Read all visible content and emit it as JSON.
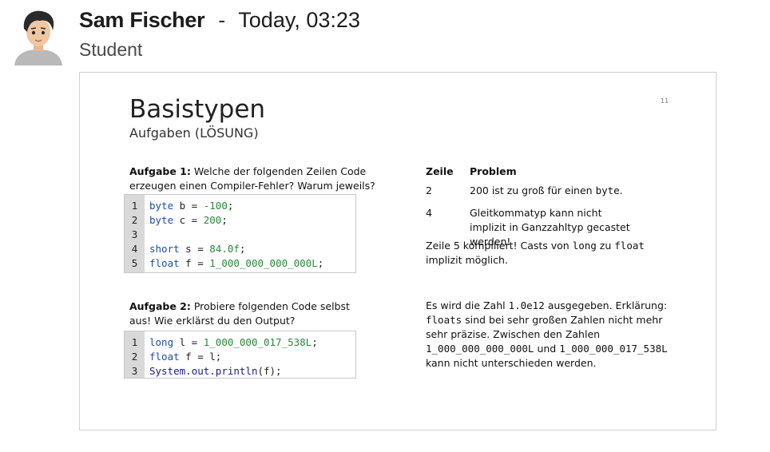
{
  "message": {
    "sender": "Sam Fischer",
    "separator": "-",
    "time": "Today, 03:23",
    "role": "Student"
  },
  "slide": {
    "title": "Basistypen",
    "subtitle": "Aufgaben (LÖSUNG)",
    "page_number": "11",
    "task1": {
      "label": "Aufgabe 1:",
      "text": " Welche der folgenden Zeilen Code erzeugen einen Compiler-Fehler? Warum jeweils?",
      "line_numbers": [
        "1",
        "2",
        "3",
        "4",
        "5"
      ],
      "code": [
        [
          [
            "kw",
            "byte"
          ],
          [
            "sym",
            " b = "
          ],
          [
            "num",
            "-100"
          ],
          [
            "sym",
            ";"
          ]
        ],
        [
          [
            "kw",
            "byte"
          ],
          [
            "sym",
            " c = "
          ],
          [
            "num",
            "200"
          ],
          [
            "sym",
            ";"
          ]
        ],
        [],
        [
          [
            "kw",
            "short"
          ],
          [
            "sym",
            " s = "
          ],
          [
            "num",
            "84.0f"
          ],
          [
            "sym",
            ";"
          ]
        ],
        [
          [
            "kw",
            "float"
          ],
          [
            "sym",
            " f = "
          ],
          [
            "num",
            "1_000_000_000_000L"
          ],
          [
            "sym",
            ";"
          ]
        ]
      ]
    },
    "task2": {
      "label": "Aufgabe 2:",
      "text": " Probiere folgenden Code selbst aus! Wie erklärst du den Output?",
      "line_numbers": [
        "1",
        "2",
        "3"
      ],
      "code": [
        [
          [
            "kw",
            "long"
          ],
          [
            "sym",
            " l = "
          ],
          [
            "num",
            "1_000_000_017_538L"
          ],
          [
            "sym",
            ";"
          ]
        ],
        [
          [
            "kw",
            "float"
          ],
          [
            "sym",
            " f = l;"
          ]
        ],
        [
          [
            "fn",
            "System"
          ],
          [
            "sym",
            "."
          ],
          [
            "fn",
            "out"
          ],
          [
            "sym",
            "."
          ],
          [
            "fn",
            "println"
          ],
          [
            "sym",
            "(f);"
          ]
        ]
      ]
    },
    "table": {
      "headers": [
        "Zeile",
        "Problem"
      ],
      "rows": [
        {
          "line": "2",
          "problem": [
            [
              "t",
              "200 ist zu groß für einen "
            ],
            [
              "m",
              "byte"
            ],
            [
              "t",
              "."
            ]
          ]
        },
        {
          "line": "4",
          "problem": [
            [
              "t",
              "Gleitkommatyp kann nicht implizit in Ganzzahltyp gecastet werden!"
            ]
          ]
        }
      ]
    },
    "note1": [
      [
        "t",
        "Zeile 5 kompiliert! Casts von "
      ],
      [
        "m",
        "long"
      ],
      [
        "t",
        " zu "
      ],
      [
        "m",
        "float"
      ],
      [
        "t",
        " implizit möglich."
      ]
    ],
    "note2": [
      [
        "t",
        "Es wird die Zahl "
      ],
      [
        "m",
        "1.0e12"
      ],
      [
        "t",
        " ausgegeben. Erklärung: "
      ],
      [
        "m",
        "floats"
      ],
      [
        "t",
        " sind bei sehr großen Zahlen nicht mehr sehr präzise. Zwischen den Zahlen "
      ],
      [
        "m",
        "1_000_000_000_000L"
      ],
      [
        "t",
        " und "
      ],
      [
        "m",
        "1_000_000_017_538L"
      ],
      [
        "t",
        " kann nicht unterschieden werden."
      ]
    ]
  }
}
